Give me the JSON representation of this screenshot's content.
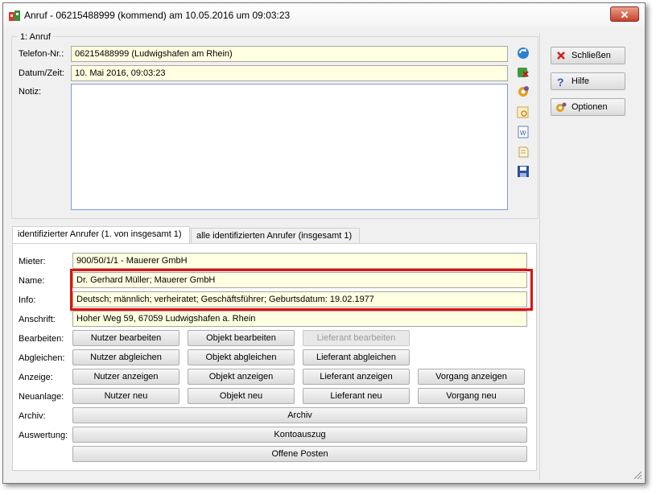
{
  "window": {
    "title": "Anruf - 06215488999 (kommend) am 10.05.2016 um 09:03:23",
    "close_glyph": "✕"
  },
  "call_group": {
    "label": "1: Anruf",
    "phone_label": "Telefon-Nr.:",
    "phone_value": "06215488999  (Ludwigshafen am Rhein)",
    "datetime_label": "Datum/Zeit:",
    "datetime_value": "10. Mai 2016,  09:03:23",
    "note_label": "Notiz:",
    "note_value": ""
  },
  "side_buttons": {
    "close": "Schließen",
    "help": "Hilfe",
    "options": "Optionen"
  },
  "tabs": [
    {
      "label": "identifizierter Anrufer  (1. von insgesamt 1)"
    },
    {
      "label": "alle identifizierten Anrufer (insgesamt 1)"
    }
  ],
  "caller": {
    "tenant_label": "Mieter:",
    "tenant_value": "900/50/1/1 - Mauerer GmbH",
    "name_label": "Name:",
    "name_value": "Dr. Gerhard Müller;  Mauerer GmbH",
    "info_label": "Info:",
    "info_value": "Deutsch;  männlich;  verheiratet;  Geschäftsführer;  Geburtsdatum: 19.02.1977",
    "address_label": "Anschrift:",
    "address_value": "Hoher Weg 59, 67059 Ludwigshafen a. Rhein"
  },
  "actions": {
    "edit_label": "Bearbeiten:",
    "edit_user": "Nutzer bearbeiten",
    "edit_object": "Objekt bearbeiten",
    "edit_supplier": "Lieferant bearbeiten",
    "sync_label": "Abgleichen:",
    "sync_user": "Nutzer abgleichen",
    "sync_object": "Objekt abgleichen",
    "sync_supplier": "Lieferant abgleichen",
    "show_label": "Anzeige:",
    "show_user": "Nutzer anzeigen",
    "show_object": "Objekt anzeigen",
    "show_supplier": "Lieferant anzeigen",
    "show_process": "Vorgang anzeigen",
    "new_label": "Neuanlage:",
    "new_user": "Nutzer neu",
    "new_object": "Objekt neu",
    "new_supplier": "Lieferant neu",
    "new_process": "Vorgang neu",
    "archive_label": "Archiv:",
    "archive_btn": "Archiv",
    "eval_label": "Auswertung:",
    "account_btn": "Kontoauszug",
    "open_items_btn": "Offene Posten"
  },
  "colors": {
    "field_bg": "#ffffe1",
    "highlight_border": "#e0120f",
    "close_button": "#c7432a"
  }
}
